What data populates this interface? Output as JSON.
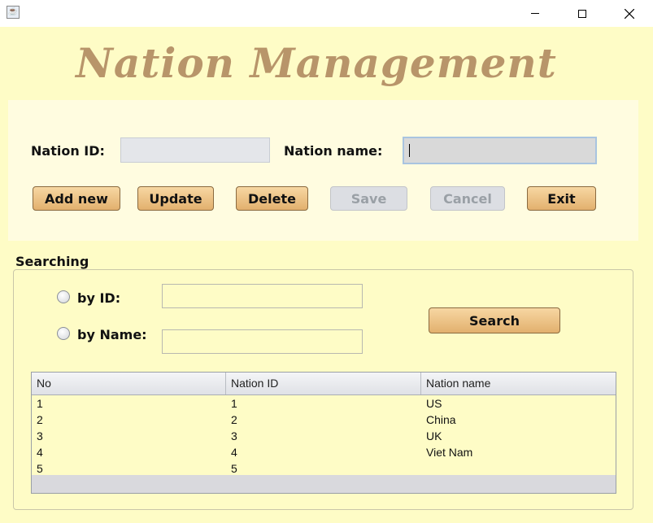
{
  "window": {
    "icon": "java-cup-icon",
    "buttons": [
      "minimize",
      "maximize",
      "close"
    ]
  },
  "app_title": "Nation Management",
  "form": {
    "nation_id_label": "Nation ID:",
    "nation_id_value": "",
    "nation_name_label": "Nation name:",
    "nation_name_value": ""
  },
  "actions": {
    "add_new": "Add new",
    "update": "Update",
    "delete": "Delete",
    "save": "Save",
    "cancel": "Cancel",
    "exit": "Exit"
  },
  "searching": {
    "title": "Searching",
    "by_id_label": "by ID:",
    "by_id_value": "",
    "by_name_label": "by Name:",
    "by_name_value": "",
    "search_button": "Search"
  },
  "table": {
    "columns": [
      "No",
      "Nation ID",
      "Nation name"
    ],
    "rows": [
      [
        "1",
        "1",
        "US"
      ],
      [
        "2",
        "2",
        "China"
      ],
      [
        "3",
        "3",
        "UK"
      ],
      [
        "4",
        "4",
        "Viet Nam"
      ],
      [
        "5",
        "5",
        ""
      ]
    ]
  },
  "colors": {
    "background": "#fefcc6",
    "title": "#b8956a",
    "button": "#e2b06e"
  }
}
